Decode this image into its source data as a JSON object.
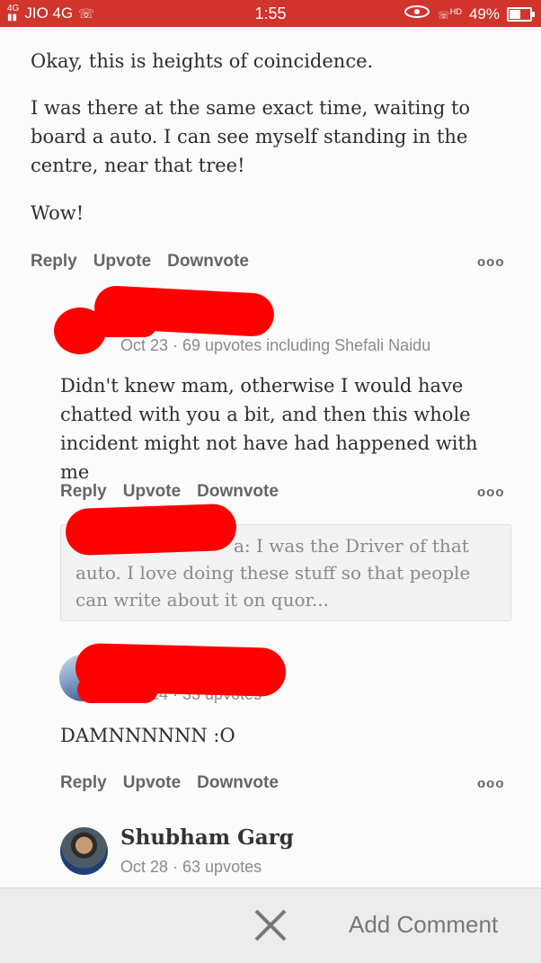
{
  "status": {
    "network_small": "4G",
    "carrier": "JIO 4G",
    "time": "1:55",
    "hd": "HD",
    "battery": "49%",
    "battery_level": 0.49
  },
  "main_comment": {
    "paragraphs": [
      "Okay, this is heights of coincidence.",
      "I was there at the same exact time, waiting to board a auto. I can see myself standing in the centre, near that tree!",
      "Wow!"
    ],
    "actions": {
      "reply": "Reply",
      "upvote": "Upvote",
      "downvote": "Downvote",
      "more": "ooo"
    }
  },
  "reply1": {
    "meta": "Oct 23 · 69 upvotes including Shefali Naidu",
    "text": "Didn't knew mam, otherwise I would have chatted with you a bit, and then this whole incident might not have had happened with me",
    "actions": {
      "reply": "Reply",
      "upvote": "Upvote",
      "downvote": "Downvote",
      "more": "ooo"
    },
    "quote_suffix": "a: I was the Driver of that auto. I love doing these stuff so that people can write about it on quor..."
  },
  "reply2": {
    "meta": "Oct 24 · 33 upvotes",
    "text": "DAMNNNNNN :O",
    "actions": {
      "reply": "Reply",
      "upvote": "Upvote",
      "downvote": "Downvote",
      "more": "ooo"
    }
  },
  "reply3": {
    "name": "Shubham Garg",
    "meta": "Oct 28 · 63 upvotes"
  },
  "bottom": {
    "add_comment": "Add Comment"
  },
  "colors": {
    "status_bar": "#d0342c",
    "redaction": "#ff0000"
  }
}
